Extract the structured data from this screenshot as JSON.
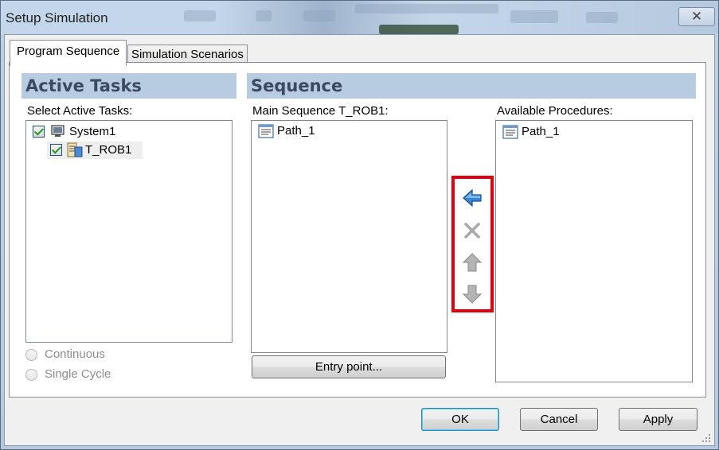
{
  "window": {
    "title": "Setup Simulation",
    "close_symbol": "✕"
  },
  "tabs": [
    {
      "label": "Program Sequence",
      "active": true
    },
    {
      "label": "Simulation Scenarios",
      "active": false
    }
  ],
  "active_tasks": {
    "header": "Active Tasks",
    "select_label": "Select Active Tasks:",
    "tree": [
      {
        "label": "System1",
        "checked": true,
        "icon": "system-icon",
        "level": 0
      },
      {
        "label": "T_ROB1",
        "checked": true,
        "icon": "task-icon",
        "level": 1
      }
    ],
    "run_modes": [
      {
        "label": "Continuous",
        "selected": false,
        "enabled": false
      },
      {
        "label": "Single Cycle",
        "selected": false,
        "enabled": false
      }
    ]
  },
  "sequence": {
    "header": "Sequence",
    "main_label": "Main Sequence T_ROB1:",
    "main_items": [
      {
        "label": "Path_1",
        "icon": "procedure-icon"
      }
    ],
    "entry_point_label": "Entry point...",
    "available_label": "Available Procedures:",
    "available_items": [
      {
        "label": "Path_1",
        "icon": "procedure-icon"
      }
    ],
    "tools": [
      {
        "name": "add-arrow-left-icon",
        "enabled": true
      },
      {
        "name": "remove-x-icon",
        "enabled": false
      },
      {
        "name": "move-up-arrow-icon",
        "enabled": false
      },
      {
        "name": "move-down-arrow-icon",
        "enabled": false
      }
    ],
    "highlight_color": "#e0000e"
  },
  "footer": {
    "ok_label": "OK",
    "cancel_label": "Cancel",
    "apply_label": "Apply"
  }
}
